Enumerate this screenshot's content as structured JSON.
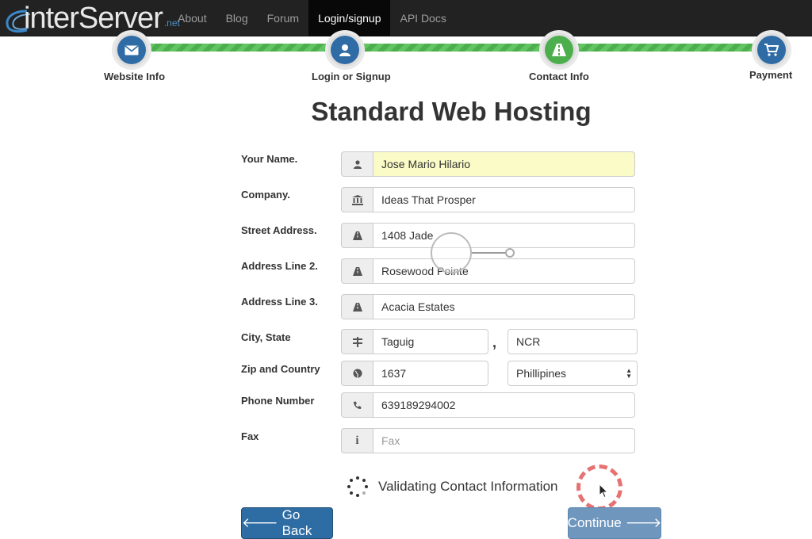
{
  "nav": {
    "logo_text": "interServer",
    "logo_suffix": ".net",
    "items": [
      "About",
      "Blog",
      "Forum",
      "Login/signup",
      "API Docs"
    ],
    "active_index": 3
  },
  "steps": [
    {
      "label": "Website Info",
      "icon": "envelope-icon",
      "status": "complete"
    },
    {
      "label": "Login or Signup",
      "icon": "user-icon",
      "status": "complete"
    },
    {
      "label": "Contact Info",
      "icon": "road-icon",
      "status": "current"
    },
    {
      "label": "Payment",
      "icon": "cart-icon",
      "status": "pending"
    }
  ],
  "title": "Standard Web Hosting",
  "form": {
    "name": {
      "label": "Your Name.",
      "value": "Jose Mario Hilario",
      "icon": "user-icon"
    },
    "company": {
      "label": "Company.",
      "value": "Ideas That Prosper",
      "icon": "bank-icon"
    },
    "street": {
      "label": "Street Address.",
      "value": "1408 Jade",
      "icon": "road-icon"
    },
    "address2": {
      "label": "Address Line 2.",
      "value": "Rosewood Pointe",
      "icon": "road-icon"
    },
    "address3": {
      "label": "Address Line 3.",
      "value": "Acacia Estates",
      "icon": "road-icon"
    },
    "city_state": {
      "label": "City, State",
      "city": "Taguig",
      "state": "NCR",
      "icon": "signpost-icon",
      "separator": ","
    },
    "zip_country": {
      "label": "Zip and Country",
      "zip": "1637",
      "country": "Phillipines",
      "icon": "globe-icon"
    },
    "phone": {
      "label": "Phone Number",
      "value": "639189294002",
      "icon": "phone-icon"
    },
    "fax": {
      "label": "Fax",
      "value": "",
      "placeholder": "Fax",
      "icon": "info-icon"
    }
  },
  "status_text": "Validating Contact Information",
  "buttons": {
    "back": "Go Back",
    "continue": "Continue"
  },
  "colors": {
    "navbar": "#222222",
    "primary": "#2e6da4",
    "progress": "#4cae4c",
    "highlight": "#fafbc7"
  }
}
